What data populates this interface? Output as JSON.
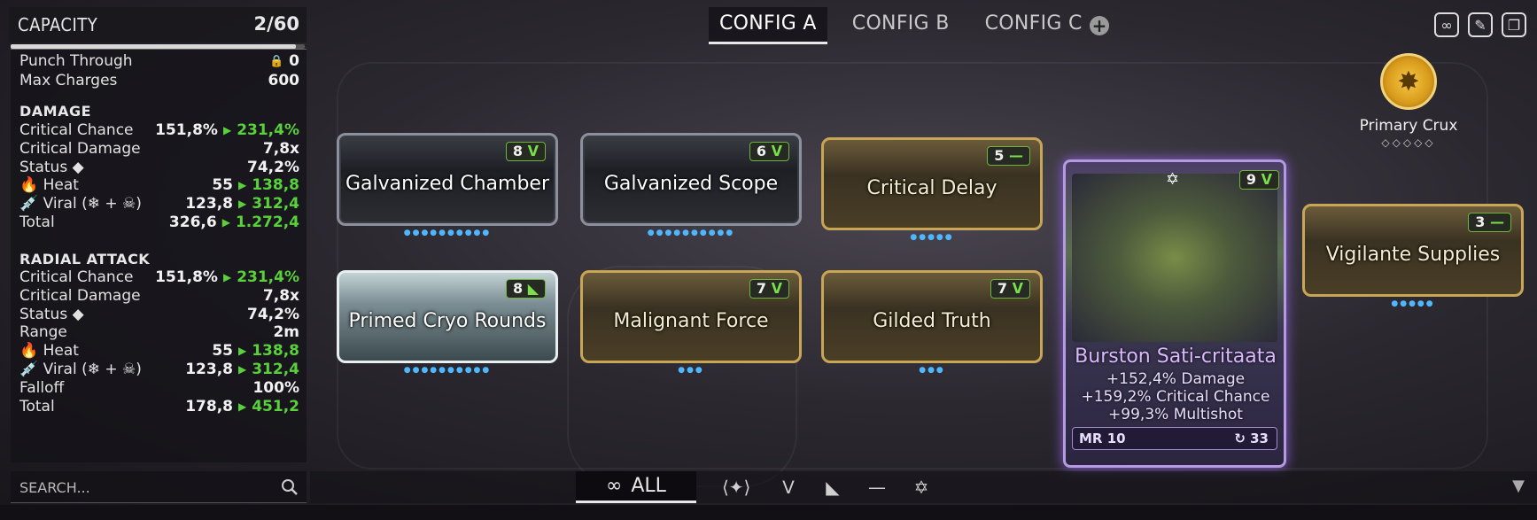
{
  "capacity": {
    "title": "CAPACITY",
    "value": "2/60",
    "fill": 0.97
  },
  "tabs": [
    {
      "label": "CONFIG A",
      "active": true
    },
    {
      "label": "CONFIG B",
      "active": false
    },
    {
      "label": "CONFIG C",
      "active": false
    }
  ],
  "tab_add": "⊕",
  "top_icons": [
    "link-icon",
    "edit-icon",
    "copy-icon"
  ],
  "stats": {
    "punch_through": {
      "label": "Punch Through",
      "value": "0"
    },
    "max_charges": {
      "label": "Max Charges",
      "value": "600"
    },
    "damage": {
      "heading": "DAMAGE",
      "rows": [
        {
          "label": "Critical Chance",
          "base": "151,8%",
          "mod": "231,4%"
        },
        {
          "label": "Critical Damage",
          "base": "7,8x",
          "mod": ""
        },
        {
          "label": "Status ◆",
          "base": "74,2%",
          "mod": ""
        },
        {
          "label": "🔥 Heat",
          "base": "55",
          "mod": "138,8"
        },
        {
          "label": "💉 Viral (❄ + ☠)",
          "base": "123,8",
          "mod": "312,4"
        },
        {
          "label": "Total",
          "base": "326,6",
          "mod": "1.272,4"
        }
      ]
    },
    "radial": {
      "heading": "RADIAL ATTACK",
      "rows": [
        {
          "label": "Critical Chance",
          "base": "151,8%",
          "mod": "231,4%"
        },
        {
          "label": "Critical Damage",
          "base": "7,8x",
          "mod": ""
        },
        {
          "label": "Status ◆",
          "base": "74,2%",
          "mod": ""
        },
        {
          "label": "Range",
          "base": "2m",
          "mod": ""
        },
        {
          "label": "🔥 Heat",
          "base": "55",
          "mod": "138,8"
        },
        {
          "label": "💉 Viral (❄ + ☠)",
          "base": "123,8",
          "mod": "312,4"
        },
        {
          "label": "Falloff",
          "base": "100%",
          "mod": ""
        },
        {
          "label": "Total",
          "base": "178,8",
          "mod": "451,2"
        }
      ]
    }
  },
  "search": {
    "placeholder": "SEARCH..."
  },
  "mods": [
    {
      "name": "Galvanized Chamber",
      "rank": "8",
      "polarity": "ᐯ",
      "style": "silver"
    },
    {
      "name": "Galvanized Scope",
      "rank": "6",
      "polarity": "ᐯ",
      "style": "silver"
    },
    {
      "name": "Critical Delay",
      "rank": "5",
      "polarity": "—",
      "style": "gold"
    },
    {
      "name": "Primed Cryo Rounds",
      "rank": "8",
      "polarity": "◣",
      "style": "primed"
    },
    {
      "name": "Malignant Force",
      "rank": "7",
      "polarity": "ᐯ",
      "style": "gold"
    },
    {
      "name": "Gilded Truth",
      "rank": "7",
      "polarity": "ᐯ",
      "style": "gold"
    },
    {
      "name": "Vigilante Supplies",
      "rank": "3",
      "polarity": "—",
      "style": "gold"
    }
  ],
  "riven": {
    "name": "Burston Sati-critaata",
    "rank": "9",
    "polarity": "ᐯ",
    "stats": [
      "+152,4% Damage",
      "+159,2% Critical Chance",
      "+99,3% Multishot"
    ],
    "mr": "MR 10",
    "rolls": "↻ 33"
  },
  "crux": {
    "label": "Primary Crux",
    "diamonds": "◇◇◇◇◇"
  },
  "filter": {
    "all_label": "ALL",
    "all_icon": "∞"
  },
  "colors": {
    "accent_green": "#58d13b",
    "riven_purple": "#b49ae0",
    "gold": "#c9a656"
  }
}
